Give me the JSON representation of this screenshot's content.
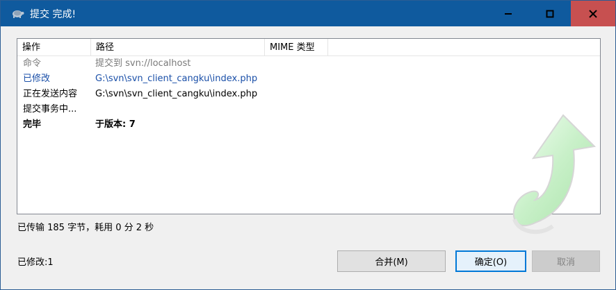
{
  "window": {
    "title": "提交 完成!"
  },
  "colors": {
    "titlebar": "#0f5a9e",
    "close_button": "#c75050",
    "link_blue": "#1a4fa8",
    "command_gray": "#7a7a7a"
  },
  "list": {
    "columns": [
      "操作",
      "路径",
      "MIME 类型"
    ],
    "rows": [
      {
        "op": "命令",
        "path": "提交到 svn://localhost"
      },
      {
        "op": "已修改",
        "path": "G:\\svn\\svn_client_cangku\\index.php"
      },
      {
        "op": "正在发送内容",
        "path": "G:\\svn\\svn_client_cangku\\index.php"
      },
      {
        "op": "提交事务中...",
        "path": ""
      },
      {
        "op": "完毕",
        "path": "于版本: 7"
      }
    ]
  },
  "status": {
    "transfer": "已传输 185 字节，耗用 0 分 2 秒",
    "modified": "已修改:1"
  },
  "buttons": {
    "merge": "合并(M)",
    "ok": "确定(O)",
    "cancel": "取消"
  }
}
